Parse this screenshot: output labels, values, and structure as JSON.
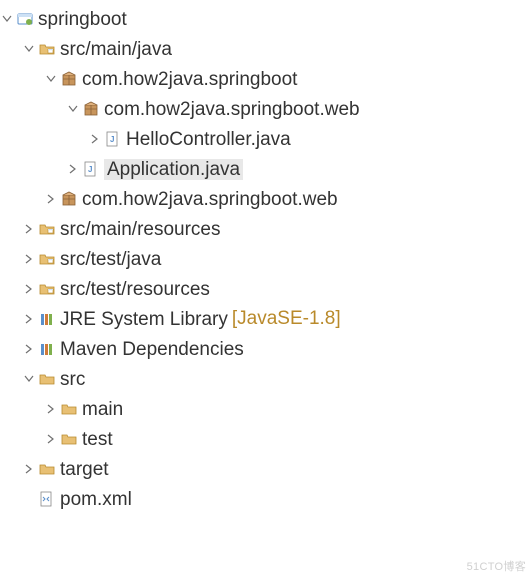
{
  "tree": {
    "root": "springboot",
    "src_main_java": "src/main/java",
    "pkg_base": "com.how2java.springboot",
    "pkg_web_expanded": "com.how2java.springboot.web",
    "hello_controller": "HelloController.java",
    "application": "Application.java",
    "pkg_web_collapsed": "com.how2java.springboot.web",
    "src_main_resources": "src/main/resources",
    "src_test_java": "src/test/java",
    "src_test_resources": "src/test/resources",
    "jre_lib": "JRE System Library",
    "jre_suffix": "[JavaSE-1.8]",
    "maven_deps": "Maven Dependencies",
    "src_folder": "src",
    "main_folder": "main",
    "test_folder": "test",
    "target_folder": "target",
    "pom_xml": "pom.xml"
  },
  "watermark": "51CTO博客"
}
